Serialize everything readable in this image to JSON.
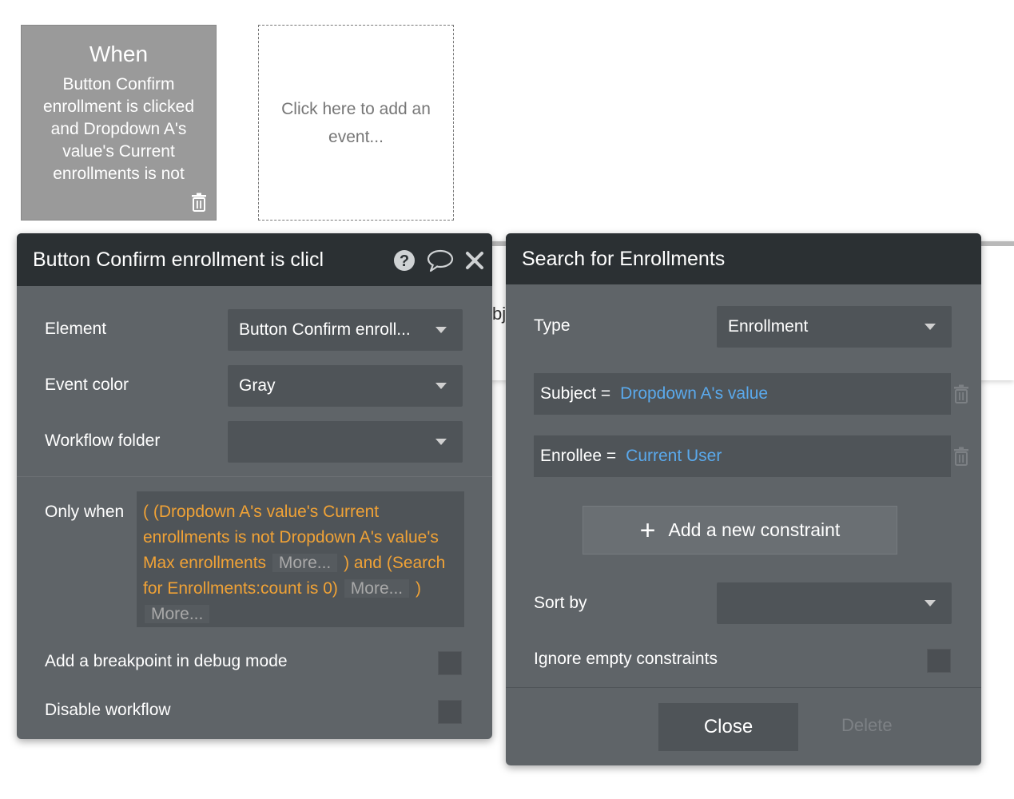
{
  "event_card": {
    "title": "When",
    "body": "Button Confirm enrollment is clicked and Dropdown A's value's Current enrollments is not Dropdown A's value's Max enrollments"
  },
  "add_event_card": {
    "label": "Click here to add an event..."
  },
  "background_panel": {
    "partial_text": "bj"
  },
  "event_panel": {
    "title": "Button Confirm enrollment is clicl",
    "element_label": "Element",
    "element_value": "Button Confirm enroll...",
    "event_color_label": "Event color",
    "event_color_value": "Gray",
    "workflow_folder_label": "Workflow folder",
    "workflow_folder_value": "",
    "only_when_label": "Only when",
    "condition": {
      "part1": "( (Dropdown A's value's Current enrollments is not Dropdown A's value's Max enrollments",
      "more1": "More...",
      "part2": ") and",
      "part3": "(Search for Enrollments:count is 0)",
      "more2": "More...",
      "part4": ")",
      "more3": "More..."
    },
    "breakpoint_label": "Add a breakpoint in debug mode",
    "disable_label": "Disable workflow"
  },
  "search_panel": {
    "title": "Search for Enrollments",
    "type_label": "Type",
    "type_value": "Enrollment",
    "constraints": [
      {
        "key": "Subject =",
        "value": "Dropdown A's value"
      },
      {
        "key": "Enrollee =",
        "value": "Current User"
      }
    ],
    "add_constraint_label": "Add a new constraint",
    "sort_by_label": "Sort by",
    "sort_by_value": "",
    "ignore_empty_label": "Ignore empty constraints",
    "close_label": "Close",
    "delete_label": "Delete"
  },
  "colors": {
    "panel_bg": "#5f6468",
    "header_bg": "#2b3033",
    "condition_text": "#f0a236",
    "constraint_value": "#5aa9ec"
  }
}
